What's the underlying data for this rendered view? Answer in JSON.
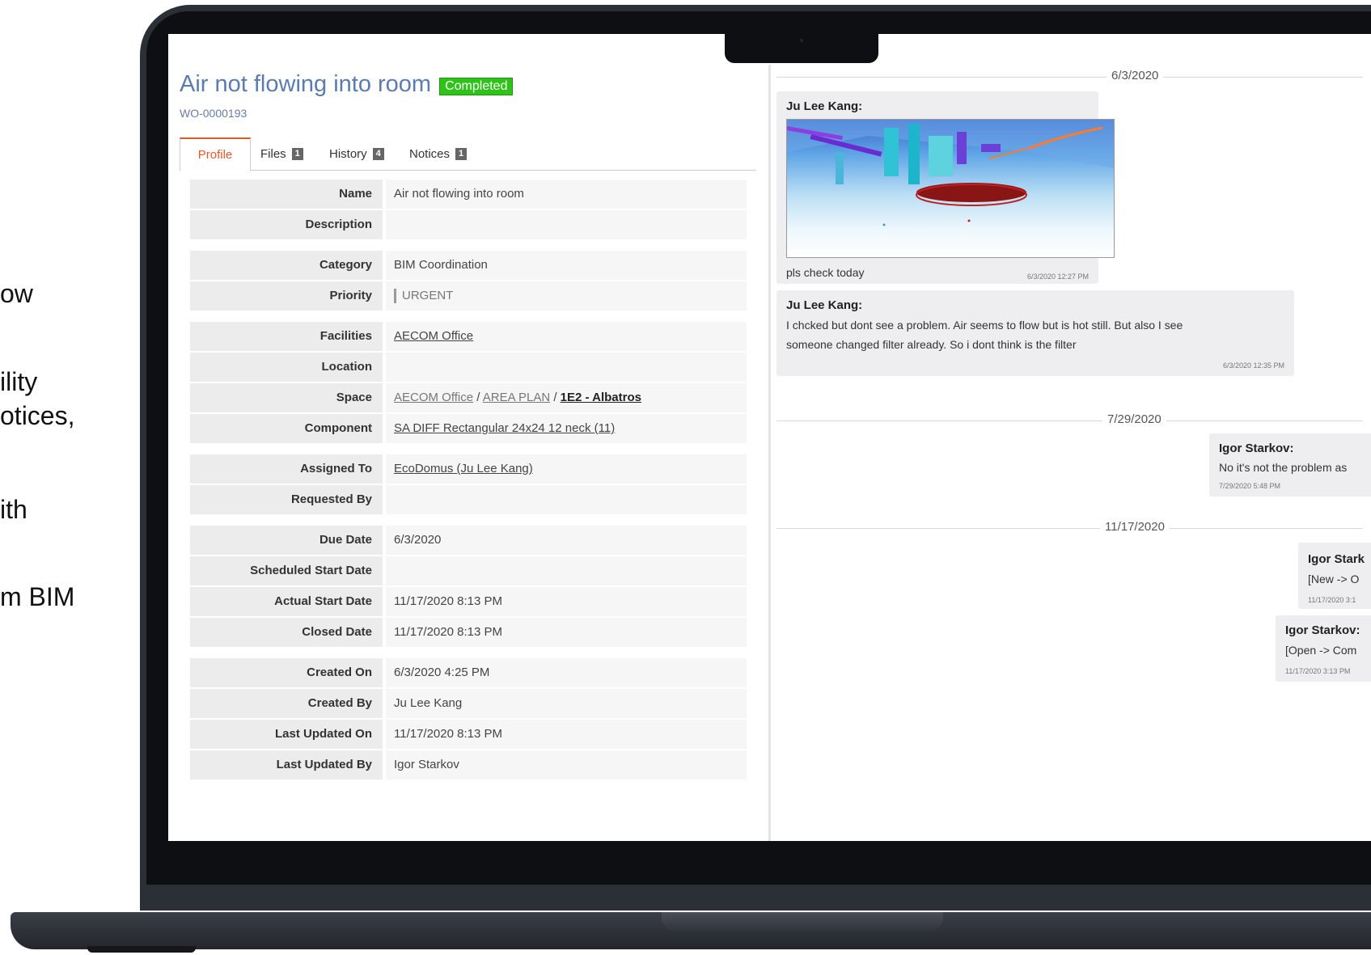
{
  "side_text": [
    "ow",
    "ility",
    "otices,",
    "ith",
    "m BIM"
  ],
  "work_order": {
    "title": "Air not flowing into room",
    "status": "Completed",
    "id": "WO-0000193"
  },
  "tabs": [
    {
      "label": "Profile"
    },
    {
      "label": "Files",
      "count": "1"
    },
    {
      "label": "History",
      "count": "4"
    },
    {
      "label": "Notices",
      "count": "1"
    }
  ],
  "profile": {
    "name": {
      "label": "Name",
      "value": "Air not flowing into room"
    },
    "description": {
      "label": "Description",
      "value": ""
    },
    "category": {
      "label": "Category",
      "value": "BIM Coordination"
    },
    "priority": {
      "label": "Priority",
      "value": "URGENT"
    },
    "facilities": {
      "label": "Facilities",
      "value": "AECOM Office"
    },
    "location": {
      "label": "Location",
      "value": ""
    },
    "space": {
      "label": "Space",
      "part1": "AECOM Office",
      "sep1": " / ",
      "part2": "AREA PLAN",
      "sep2": " / ",
      "part3": "1E2 - Albatros"
    },
    "component": {
      "label": "Component",
      "value": "SA DIFF Rectangular 24x24 12 neck (11)"
    },
    "assigned_to": {
      "label": "Assigned To",
      "value": "EcoDomus (Ju Lee Kang)"
    },
    "requested_by": {
      "label": "Requested By",
      "value": ""
    },
    "due_date": {
      "label": "Due Date",
      "value": "6/3/2020"
    },
    "scheduled_start": {
      "label": "Scheduled Start Date",
      "value": ""
    },
    "actual_start": {
      "label": "Actual Start Date",
      "value": "11/17/2020 8:13 PM"
    },
    "closed_date": {
      "label": "Closed Date",
      "value": "11/17/2020 8:13 PM"
    },
    "created_on": {
      "label": "Created On",
      "value": "6/3/2020 4:25 PM"
    },
    "created_by": {
      "label": "Created By",
      "value": "Ju Lee Kang"
    },
    "last_updated_on": {
      "label": "Last Updated On",
      "value": "11/17/2020 8:13 PM"
    },
    "last_updated_by": {
      "label": "Last Updated By",
      "value": "Igor Starkov"
    }
  },
  "chat": {
    "dates": [
      "6/3/2020",
      "7/29/2020",
      "11/17/2020"
    ],
    "messages": [
      {
        "author": "Ju Lee Kang:",
        "text": "pls check today",
        "time": "6/3/2020 12:27 PM"
      },
      {
        "author": "Ju Lee Kang:",
        "text1": "I chcked but dont see a problem. Air seems to flow but is hot still. But also I see",
        "text2": "someone changed filter already. So i dont think is the filter",
        "time": "6/3/2020 12:35 PM"
      },
      {
        "author": "Igor Starkov:",
        "text": "No it's not the problem as",
        "time": "7/29/2020 5:48 PM"
      },
      {
        "author": "Igor Stark",
        "text": "[New -> O",
        "time": "11/17/2020 3:1"
      },
      {
        "author": "Igor Starkov:",
        "text": "[Open -> Com",
        "time": "11/17/2020 3:13 PM"
      }
    ]
  }
}
